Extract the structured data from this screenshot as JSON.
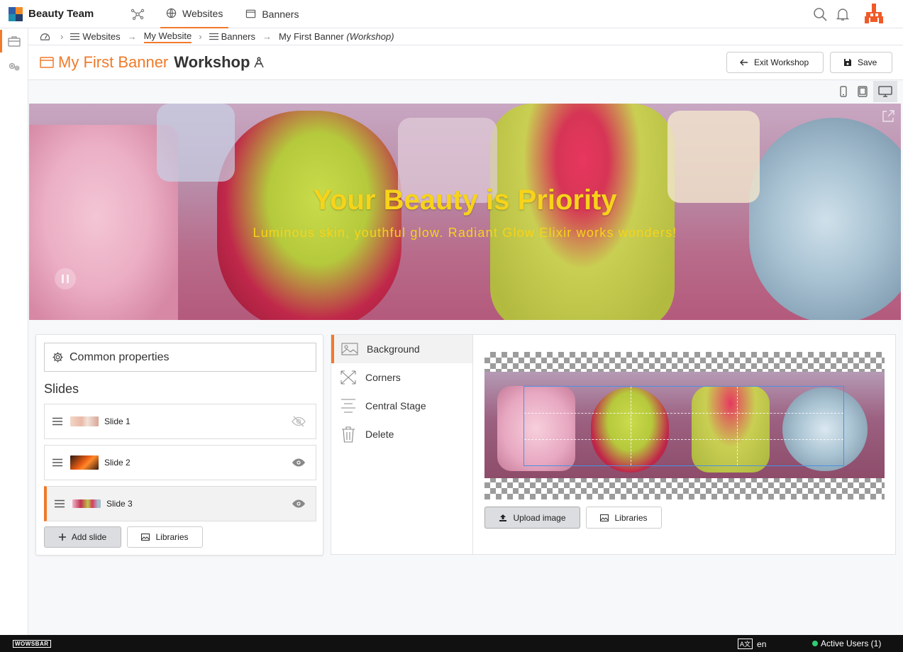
{
  "app": {
    "brand": "Beauty Team"
  },
  "nav": {
    "tabs": [
      {
        "label": "Websites"
      },
      {
        "label": "Banners"
      }
    ]
  },
  "breadcrumb": {
    "items": [
      "Websites",
      "My Website",
      "Banners"
    ],
    "current": "My First Banner",
    "current_suffix": "(Workshop)"
  },
  "header": {
    "title": "My First Banner",
    "subtitle": "Workshop",
    "exit_label": "Exit Workshop",
    "save_label": "Save"
  },
  "banner": {
    "title": "Your Beauty is Priority",
    "subtitle": "Luminous skin, youthful glow. Radiant Glow Elixir works wonders!",
    "text_color": "#f7d31a"
  },
  "slides_panel": {
    "common_label": "Common properties",
    "heading": "Slides",
    "slides": [
      {
        "label": "Slide 1",
        "visible": false
      },
      {
        "label": "Slide 2",
        "visible": true
      },
      {
        "label": "Slide 3",
        "visible": true,
        "selected": true
      }
    ],
    "add_label": "Add slide",
    "libraries_label": "Libraries"
  },
  "properties": {
    "menu": [
      "Background",
      "Corners",
      "Central Stage",
      "Delete"
    ],
    "active": "Background",
    "upload_label": "Upload image",
    "libraries_label": "Libraries"
  },
  "footer": {
    "logo": "WOWSBAR",
    "language": "en",
    "active_users": "Active Users (1)"
  },
  "colors": {
    "accent": "#f07a2a",
    "online": "#2ecc71"
  }
}
